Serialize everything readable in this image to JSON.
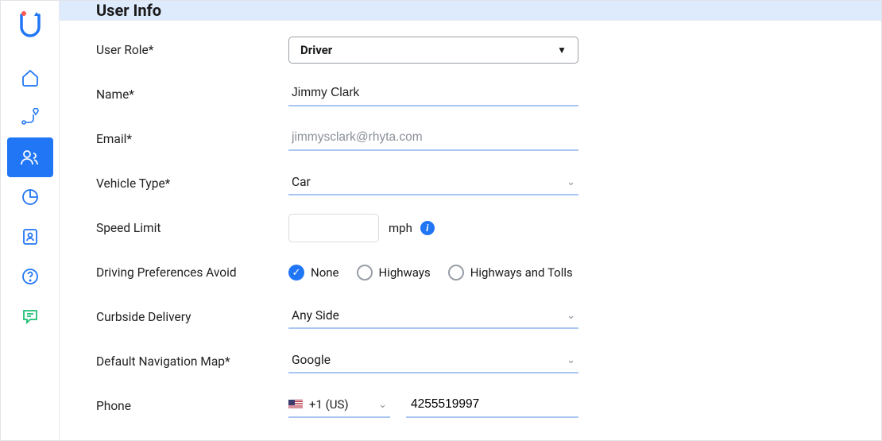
{
  "header": {
    "title": "User Info"
  },
  "form": {
    "role": {
      "label": "User Role*",
      "value": "Driver"
    },
    "name": {
      "label": "Name*",
      "value": "Jimmy Clark"
    },
    "email": {
      "label": "Email*",
      "value": "jimmysclark@rhyta.com"
    },
    "vehicle": {
      "label": "Vehicle Type*",
      "value": "Car"
    },
    "speed": {
      "label": "Speed Limit",
      "value": "",
      "unit": "mph"
    },
    "prefs": {
      "label": "Driving Preferences Avoid",
      "options": [
        "None",
        "Highways",
        "Highways and Tolls"
      ],
      "selected": "None"
    },
    "curbside": {
      "label": "Curbside Delivery",
      "value": "Any Side"
    },
    "navmap": {
      "label": "Default Navigation Map*",
      "value": "Google"
    },
    "phone": {
      "label": "Phone",
      "country": "+1 (US)",
      "value": "4255519997"
    }
  },
  "nav": {
    "logo": "logo-icon",
    "items": [
      {
        "id": "home",
        "icon": "home-icon"
      },
      {
        "id": "route",
        "icon": "route-icon"
      },
      {
        "id": "users",
        "icon": "users-icon",
        "active": true
      },
      {
        "id": "reports",
        "icon": "chart-icon"
      },
      {
        "id": "contacts",
        "icon": "contact-icon"
      },
      {
        "id": "help",
        "icon": "help-icon"
      },
      {
        "id": "chat",
        "icon": "chat-icon",
        "green": true
      }
    ]
  }
}
